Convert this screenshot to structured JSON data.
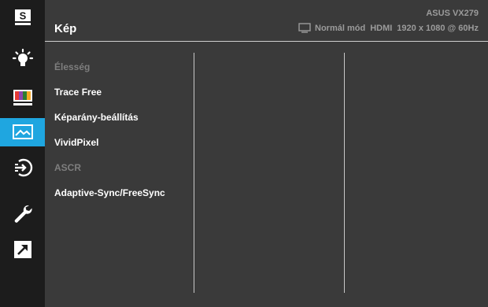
{
  "header": {
    "model": "ASUS VX279",
    "title": "Kép",
    "mode": "Normál mód",
    "input": "HDMI",
    "resolution": "1920 x 1080 @ 60Hz"
  },
  "sidebar": {
    "items": [
      {
        "name": "splendid",
        "icon": "s-icon",
        "active": false
      },
      {
        "name": "blue-light-filter",
        "icon": "lightbulb-icon",
        "active": false
      },
      {
        "name": "color",
        "icon": "color-bars-icon",
        "active": false
      },
      {
        "name": "image",
        "icon": "picture-icon",
        "active": true
      },
      {
        "name": "input-select",
        "icon": "input-icon",
        "active": false
      },
      {
        "name": "system-setup",
        "icon": "wrench-icon",
        "active": false
      },
      {
        "name": "shortcut",
        "icon": "shortcut-arrow-icon",
        "active": false
      }
    ]
  },
  "menu": {
    "items": [
      {
        "label": "Élesség",
        "enabled": false
      },
      {
        "label": "Trace Free",
        "enabled": true
      },
      {
        "label": "Képarány-beállítás",
        "enabled": true
      },
      {
        "label": "VividPixel",
        "enabled": true
      },
      {
        "label": "ASCR",
        "enabled": false
      },
      {
        "label": "Adaptive-Sync/FreeSync",
        "enabled": true
      }
    ]
  },
  "colors": {
    "background": "#3a3a3a",
    "sidebar": "#1c1c1c",
    "accent": "#1fa6e0",
    "text": "#ffffff",
    "disabled_text": "#7e7e7e",
    "muted_text": "#9b9b9b"
  }
}
